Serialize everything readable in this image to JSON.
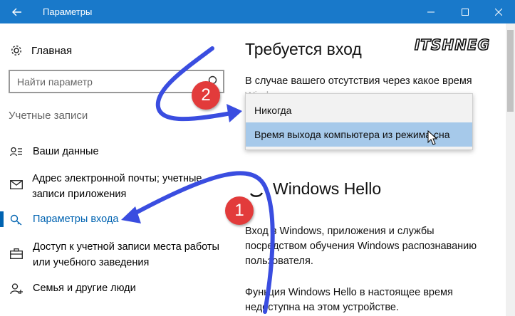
{
  "window": {
    "title": "Параметры",
    "accent": "#1979ca"
  },
  "sidebar": {
    "home_label": "Главная",
    "search_placeholder": "Найти параметр",
    "section_title": "Учетные записи",
    "items": [
      {
        "label": "Ваши данные",
        "icon": "person-card-icon"
      },
      {
        "label": "Адрес электронной почты; учетные записи приложения",
        "icon": "mail-icon"
      },
      {
        "label": "Параметры входа",
        "icon": "key-icon",
        "active": true
      },
      {
        "label": "Доступ к учетной записи места работы или учебного заведения",
        "icon": "briefcase-icon"
      },
      {
        "label": "Семья и другие люди",
        "icon": "person-add-icon"
      }
    ]
  },
  "main": {
    "signin_required_title": "Требуется вход",
    "signin_required_text": "В случае вашего отсутствия через какое время",
    "signin_required_text_2": "Windows ... ",
    "dropdown_options": [
      "Никогда",
      "Время выхода компьютера из режима сна"
    ],
    "dropdown_selected": "Время выхода компьютера из режима сна",
    "hello_title": "Windows Hello",
    "hello_text_1": "Вход в Windows, приложения и службы",
    "hello_text_2": "посредством обучения Windows распознаванию",
    "hello_text_3": "пользователя.",
    "hello_text_4": "Функция Windows Hello в настоящее время",
    "hello_text_5": "недоступна на этом устройстве."
  },
  "watermark": "ITSHNEG",
  "annotations": {
    "badge_1": "1",
    "badge_2": "2",
    "badge_color": "#e23b3b",
    "arrow_color": "#3a4de0"
  }
}
